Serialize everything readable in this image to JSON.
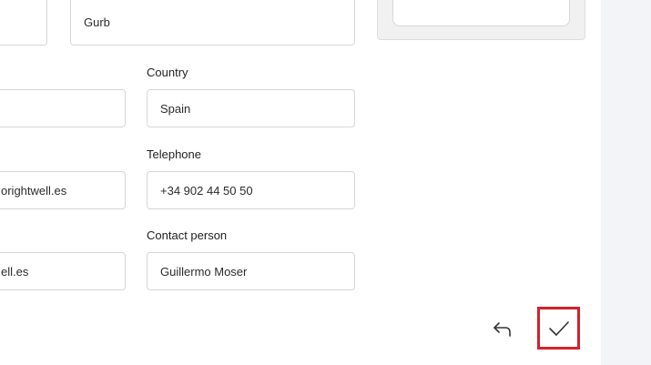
{
  "form": {
    "top_row": {
      "right_value": "Gurb"
    },
    "country": {
      "label": "Country",
      "value": "Spain",
      "left_value": ""
    },
    "telephone": {
      "label": "Telephone",
      "value": "+34 902 44 50 50",
      "left_value": "orightwell.es"
    },
    "contact_person": {
      "label": "Contact person",
      "value": "Guillermo Moser",
      "left_value": "ell.es"
    }
  },
  "actions": {
    "back_icon": "undo-arrow-icon",
    "confirm_icon": "checkmark-icon"
  },
  "colors": {
    "accent_border": "#d5202a",
    "side_panel": "#f3f4f8",
    "field_border": "#d6d6d6"
  }
}
